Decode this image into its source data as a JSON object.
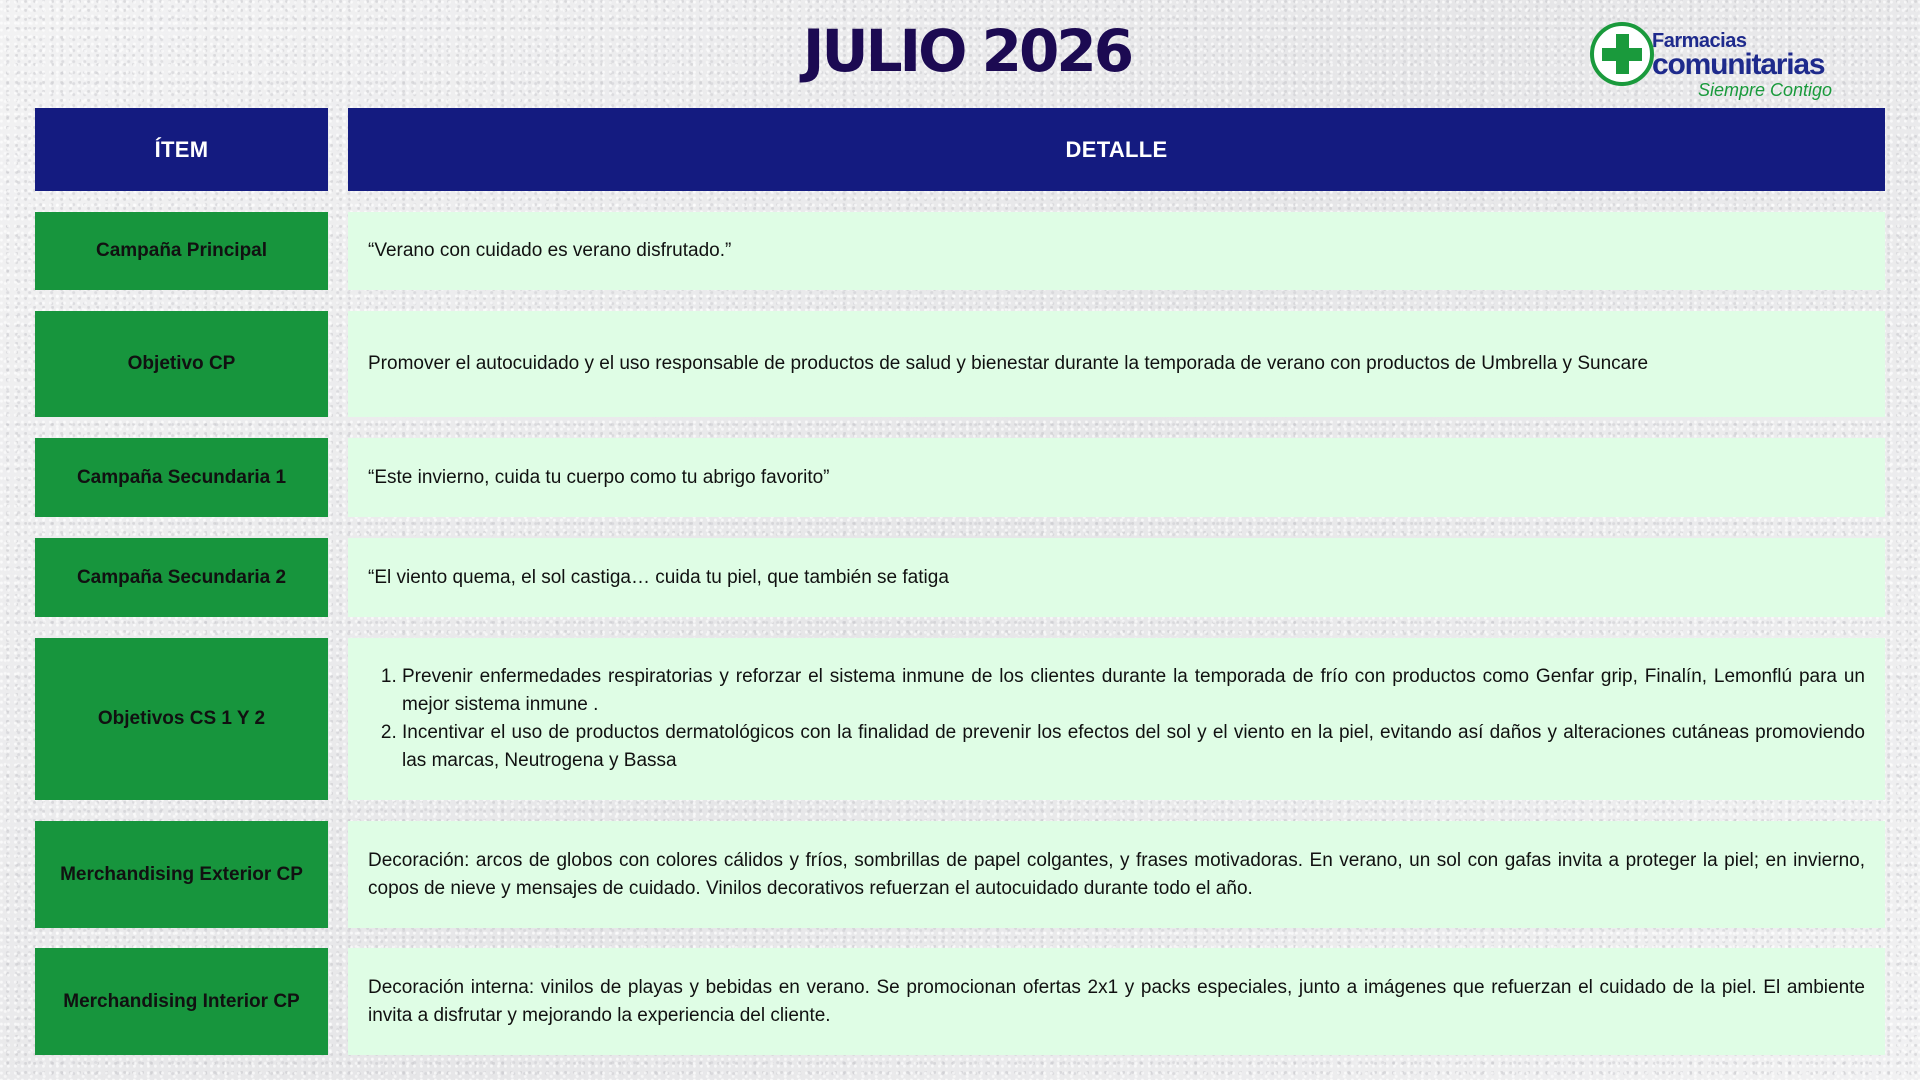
{
  "title": "JULIO 2026",
  "logo": {
    "line1": "Farmacias",
    "line2": "comunitarias",
    "tagline": "Siempre Contigo",
    "colors": {
      "blue": "#1e2a8c",
      "green": "#1a9a3c"
    }
  },
  "colors": {
    "header_bg": "#141b80",
    "item_bg": "#17953d",
    "detail_bg": "#dffde5",
    "title_color": "#1c0a52"
  },
  "table": {
    "headers": {
      "item": "ÍTEM",
      "detail": "DETALLE"
    },
    "rows": [
      {
        "item": "Campaña Principal",
        "detail": "“Verano con cuidado es verano disfrutado.”"
      },
      {
        "item": "Objetivo CP",
        "detail": "Promover el autocuidado y el uso responsable de productos de salud y bienestar durante la temporada de verano con productos de Umbrella y Suncare"
      },
      {
        "item": "Campaña Secundaria 1",
        "detail": "“Este invierno, cuida tu cuerpo  como tu abrigo favorito”"
      },
      {
        "item": "Campaña Secundaria 2",
        "detail": "“El viento quema, el sol castiga… cuida tu piel, que también se fatiga"
      },
      {
        "item": "Objetivos CS 1 Y 2",
        "list": [
          "Prevenir enfermedades respiratorias y reforzar el sistema inmune de los clientes durante la temporada de frío con productos  como Genfar grip, Finalín, Lemonflú para un mejor sistema inmune .",
          " Incentivar el uso de productos dermatológicos con la finalidad de prevenir los efectos del sol y el viento en la piel, evitando así daños y alteraciones cutáneas promoviendo las marcas, Neutrogena y Bassa"
        ]
      },
      {
        "item": "Merchandising Exterior CP",
        "detail": "Decoración: arcos de globos con colores cálidos y fríos, sombrillas de papel colgantes, y frases motivadoras. En verano, un sol con gafas invita a proteger la piel; en invierno, copos de nieve y mensajes de cuidado. Vinilos decorativos refuerzan el autocuidado durante todo el año."
      },
      {
        "item": "Merchandising Interior CP",
        "detail": "Decoración interna: vinilos de playas y bebidas en verano. Se promocionan ofertas 2x1 y packs especiales, junto a imágenes que refuerzan el cuidado de la piel. El ambiente invita a disfrutar y mejorando la experiencia del cliente."
      }
    ]
  }
}
